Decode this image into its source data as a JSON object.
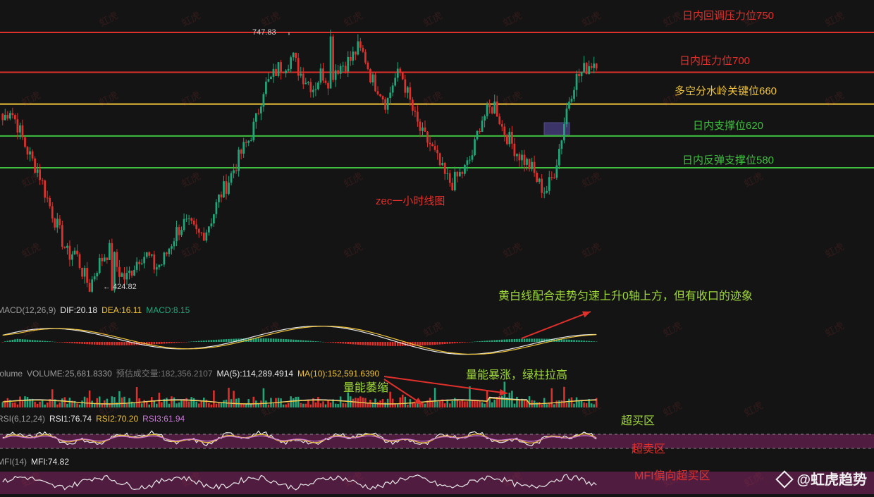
{
  "chart_data": {
    "type": "candlestick",
    "title": "zec一小时线图",
    "price_marks": {
      "high": "747.83",
      "low": "424.82"
    },
    "levels": [
      {
        "value": 750,
        "label": "日内回调压力位750",
        "color": "#e0302c"
      },
      {
        "value": 700,
        "label": "日内压力位700",
        "color": "#e0302c"
      },
      {
        "value": 660,
        "label": "多空分水岭关键位660",
        "color": "#f0c43a"
      },
      {
        "value": 620,
        "label": "日内支撑位620",
        "color": "#3fbf3f"
      },
      {
        "value": 580,
        "label": "日内反弹支撑位580",
        "color": "#3fbf3f"
      }
    ],
    "close_path": [
      640,
      655,
      635,
      610,
      590,
      575,
      545,
      520,
      495,
      470,
      475,
      450,
      430,
      455,
      470,
      478,
      450,
      440,
      455,
      470,
      470,
      455,
      460,
      480,
      500,
      510,
      505,
      495,
      500,
      520,
      545,
      560,
      580,
      600,
      615,
      640,
      680,
      690,
      705,
      710,
      720,
      700,
      690,
      680,
      700,
      690,
      705,
      710,
      715,
      730,
      720,
      690,
      680,
      660,
      690,
      700,
      670,
      640,
      620,
      610,
      590,
      570,
      560,
      570,
      580,
      600,
      640,
      650,
      660,
      630,
      615,
      600,
      590,
      580,
      560,
      550,
      570,
      610,
      660,
      690,
      700,
      710,
      715
    ]
  },
  "macd": {
    "label": "MACD(12,26,9)",
    "dif": "DIF:20.18",
    "dea": "DEA:16.11",
    "macd": "MACD:8.15"
  },
  "volume": {
    "label": "Volume",
    "vol": "VOLUME:25,681.8330",
    "est": "预估成交量:182,356.2107",
    "ma5": "MA(5):114,289.4914",
    "ma10": "MA(10):152,591.6390"
  },
  "rsi": {
    "label": "RSI(6,12,24)",
    "rsi1": "RSI1:76.74",
    "rsi2": "RSI2:70.20",
    "rsi3": "RSI3:61.94"
  },
  "mfi": {
    "label": "MFI(14)",
    "mfi": "MFI:74.82"
  },
  "annotations": {
    "macd_note": "黄白线配合走势匀速上升0轴上方，但有收口的迹象",
    "vol_shrink": "量能萎缩",
    "vol_surge": "量能暴涨，绿柱拉高",
    "overbought": "超买区",
    "oversold": "超卖区",
    "mfi_note": "MFI偏向超买区"
  },
  "watermark_text": "虹虎",
  "brand": "@虹虎趋势",
  "colors": {
    "up": "#1fa67a",
    "down": "#e0302c",
    "dif": "#e8e8e8",
    "dea": "#f0c43a",
    "rsi1": "#e8e8e8",
    "rsi2": "#f0c43a",
    "rsi3": "#c878d6",
    "band": "#5a1f48"
  }
}
